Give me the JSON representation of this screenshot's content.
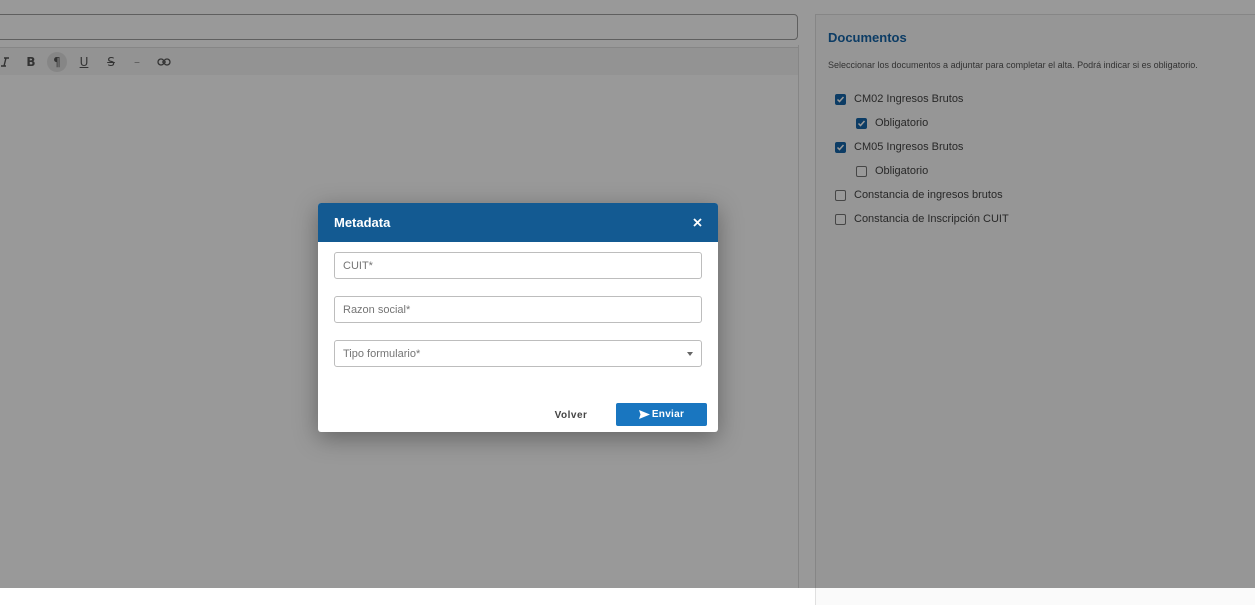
{
  "editor": {
    "toolbar": {
      "italic_icon": "italic-icon",
      "bold_label": "B",
      "paragraph_label": "¶",
      "underline_label": "U",
      "strike_label": "S",
      "dash_label": "–",
      "link_icon": "link-icon"
    }
  },
  "documents": {
    "title": "Documentos",
    "description": "Seleccionar los documentos a adjuntar para completar el alta. Podrá indicar si es obligatorio.",
    "items": [
      {
        "label": "CM02 Ingresos Brutos",
        "checked": true
      },
      {
        "label": "Obligatorio",
        "checked": true
      },
      {
        "label": "CM05 Ingresos Brutos",
        "checked": true
      },
      {
        "label": "Obligatorio",
        "checked": false
      },
      {
        "label": "Constancia de ingresos brutos",
        "checked": false
      },
      {
        "label": "Constancia de Inscripción CUIT",
        "checked": false
      }
    ]
  },
  "modal": {
    "title": "Metadata",
    "close_icon": "close-icon",
    "fields": {
      "cuit_placeholder": "CUIT*",
      "razon_social_placeholder": "Razon social*",
      "tipo_formulario_placeholder": "Tipo formulario*"
    },
    "buttons": {
      "volver": "Volver",
      "enviar": "Enviar"
    }
  },
  "colors": {
    "header_bg": "#135a92",
    "accent": "#1976c0",
    "doc_title": "#1565a8"
  }
}
